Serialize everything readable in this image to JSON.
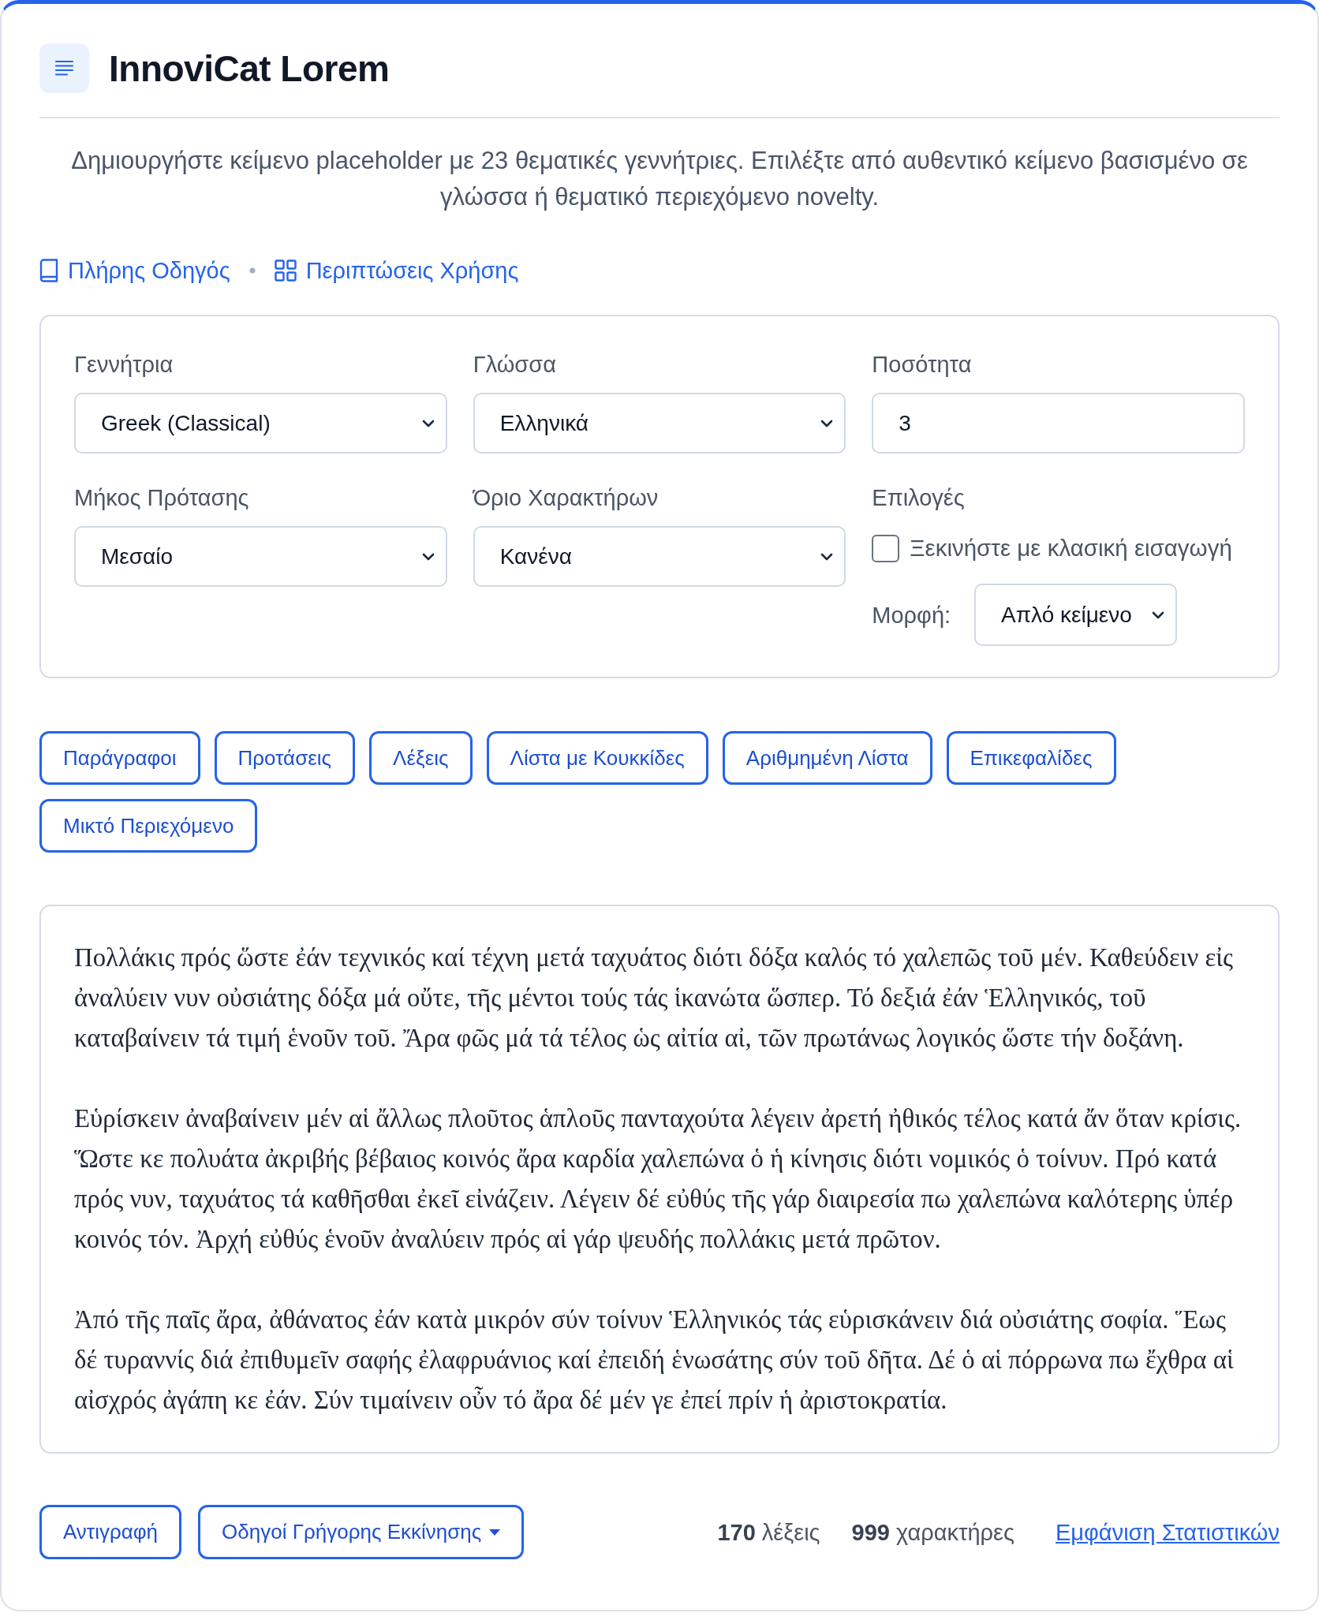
{
  "header": {
    "title": "InnoviCat Lorem"
  },
  "description": "Δημιουργήστε κείμενο placeholder με 23 θεματικές γεννήτριες. Επιλέξτε από αυθεντικό κείμενο βασισμένο σε γλώσσα ή θεματικό περιεχόμενο novelty.",
  "links": [
    {
      "label": "Πλήρης Οδηγός",
      "kind": "book"
    },
    {
      "label": "Περιπτώσεις Χρήσης",
      "kind": "grid"
    }
  ],
  "form": {
    "fields": [
      {
        "label": "Γεννήτρια",
        "kind": "select",
        "value": "Greek (Classical)"
      },
      {
        "label": "Γλώσσα",
        "kind": "select",
        "value": "Ελληνικά"
      },
      {
        "label": "Ποσότητα",
        "kind": "number",
        "value": "3"
      },
      {
        "label": "Μήκος Πρότασης",
        "kind": "select",
        "value": "Μεσαίο"
      },
      {
        "label": "Όριο Χαρακτήρων",
        "kind": "select",
        "value": "Κανένα"
      },
      {
        "label": "Επιλογές",
        "kind": "options",
        "checkbox": {
          "label": "Ξεκινήστε με κλασική εισαγωγή",
          "checked": false
        },
        "format": {
          "label": "Μορφή:",
          "value": "Απλό κείμενο"
        }
      }
    ]
  },
  "mode_buttons": [
    "Παράγραφοι",
    "Προτάσεις",
    "Λέξεις",
    "Λίστα με Κουκκίδες",
    "Αριθμημένη Λίστα",
    "Επικεφαλίδες",
    "Μικτό Περιεχόμενο"
  ],
  "output": {
    "paragraphs": [
      "Πολλάκις πρός ὥστε ἐάν τεχνικός καί τέχνη μετά ταχυάτος διότι δόξα καλός τό χαλεπῶς τοῦ μέν. Καθεύδειν εἰς ἀναλύειν νυν οὐσιάτης δόξα μά οὔτε, τῆς μέντοι τούς τάς ἱκανώτα ὥσπερ. Τό δεξιά ἐάν Ἑλληνικός, τοῦ καταβαίνειν τά τιμή ἑνοῦν τοῦ. Ἄρα φῶς μά τά τέλος ὡς αἰτία αἰ, τῶν πρωτάνως λογικός ὥστε τήν δοξάνη.",
      "Εὑρίσκειν ἀναβαίνειν μέν αἱ ἄλλως πλοῦτος ἁπλοῦς πανταχούτα λέγειν ἀρετή ἠθικός τέλος κατά ἄν ὅταν κρίσις. Ὥστε κε πολυάτα ἀκριβής βέβαιος κοινός ἄρα καρδία χαλεπώνα ὁ ἡ κίνησις διότι νομικός ὁ τοίνυν. Πρό κατά πρός νυν, ταχυάτος τά καθῆσθαι ἐκεῖ εἰνάζειν. Λέγειν δέ εὐθύς τῆς γάρ διαιρεσία πω χαλεπώνα καλότερης ὑπέρ κοινός τόν. Ἀρχή εὐθύς ἑνοῦν ἀναλύειν πρός αἱ γάρ ψευδής πολλάκις μετά πρῶτον.",
      "Ἀπό τῆς παῖς ἄρα, ἀθάνατος ἐάν κατὰ μικρόν σύν τοίνυν Ἑλληνικός τάς εὑρισκάνειν διά οὐσιάτης σοφία. Ἕως δέ τυραννίς διά ἐπιθυμεῖν σαφής ἐλαφρυάνιος καί ἐπειδή ἑνωσάτης σύν τοῦ δῆτα. Δέ ὁ αἱ πόρρωνα πω ἔχθρα αἱ αἰσχρός ἀγάπη κε ἐάν. Σύν τιμαίνειν οὖν τό ἄρα δέ μέν γε ἐπεί πρίν ἡ ἀριστοκρατία."
    ]
  },
  "footer": {
    "buttons": [
      {
        "label": "Αντιγραφή",
        "kind": "plain"
      },
      {
        "label": "Οδηγοί Γρήγορης Εκκίνησης",
        "kind": "dropdown"
      }
    ],
    "stats": [
      {
        "count": "170",
        "unit": "λέξεις"
      },
      {
        "count": "999",
        "unit": "χαρακτήρες"
      }
    ],
    "link": "Εμφάνιση Στατιστικών"
  }
}
